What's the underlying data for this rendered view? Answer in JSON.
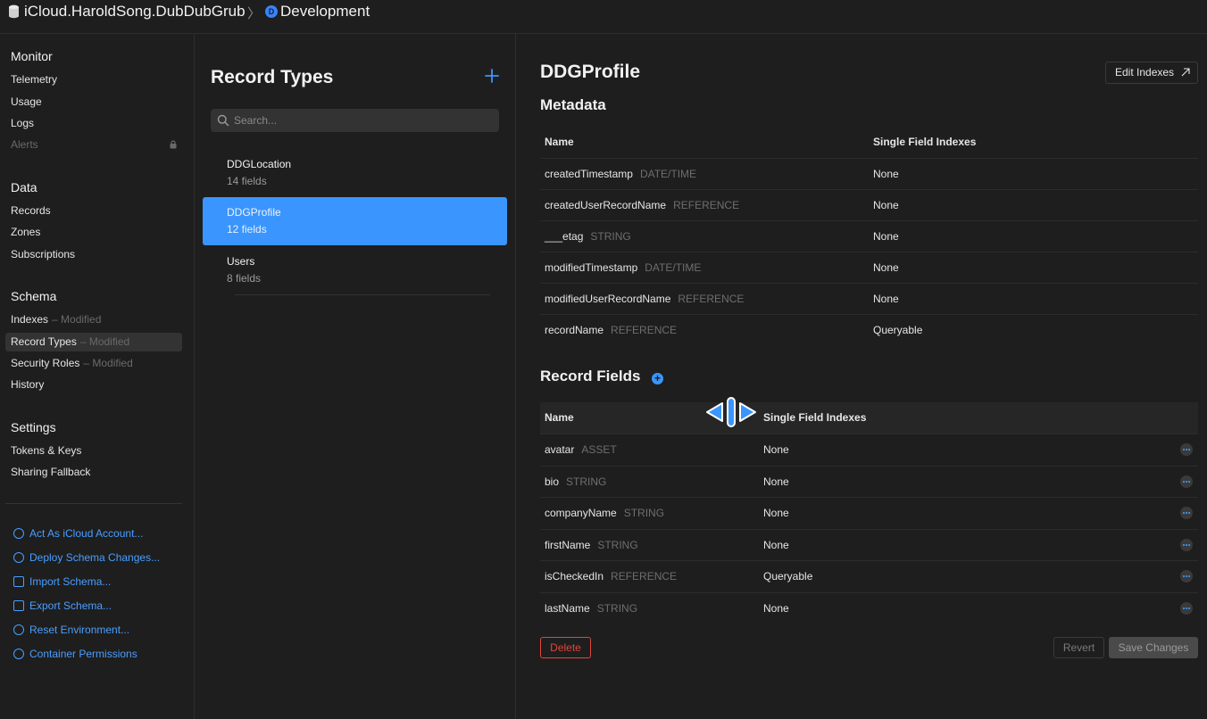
{
  "topbar": {
    "container": "iCloud.HaroldSong.DubDubGrub",
    "separator": "〉",
    "environment": "Development",
    "env_badge": "D"
  },
  "sidebar": {
    "monitor": {
      "heading": "Monitor",
      "items": [
        "Telemetry",
        "Usage",
        "Logs",
        "Alerts"
      ]
    },
    "data": {
      "heading": "Data",
      "items": [
        "Records",
        "Zones",
        "Subscriptions"
      ]
    },
    "schema": {
      "heading": "Schema",
      "items": [
        {
          "label": "Indexes",
          "status": "– Modified"
        },
        {
          "label": "Record Types",
          "status": "– Modified"
        },
        {
          "label": "Security Roles",
          "status": "– Modified"
        },
        {
          "label": "History",
          "status": ""
        }
      ]
    },
    "settings": {
      "heading": "Settings",
      "items": [
        "Tokens & Keys",
        "Sharing Fallback"
      ]
    },
    "actions": [
      "Act As iCloud Account...",
      "Deploy Schema Changes...",
      "Import Schema...",
      "Export Schema...",
      "Reset Environment...",
      "Container Permissions"
    ]
  },
  "record_types": {
    "title": "Record Types",
    "search_placeholder": "Search...",
    "items": [
      {
        "name": "DDGLocation",
        "fields": "14 fields"
      },
      {
        "name": "DDGProfile",
        "fields": "12 fields"
      },
      {
        "name": "Users",
        "fields": "8 fields"
      }
    ]
  },
  "detail": {
    "title": "DDGProfile",
    "edit_indexes": "Edit Indexes",
    "metadata": {
      "title": "Metadata",
      "col_name": "Name",
      "col_index": "Single Field Indexes",
      "rows": [
        {
          "name": "createdTimestamp",
          "type": "DATE/TIME",
          "index": "None"
        },
        {
          "name": "createdUserRecordName",
          "type": "REFERENCE",
          "index": "None"
        },
        {
          "name": "___etag",
          "type": "STRING",
          "index": "None"
        },
        {
          "name": "modifiedTimestamp",
          "type": "DATE/TIME",
          "index": "None"
        },
        {
          "name": "modifiedUserRecordName",
          "type": "REFERENCE",
          "index": "None"
        },
        {
          "name": "recordName",
          "type": "REFERENCE",
          "index": "Queryable"
        }
      ]
    },
    "record_fields": {
      "title": "Record Fields",
      "col_name": "Name",
      "col_index": "Single Field Indexes",
      "rows": [
        {
          "name": "avatar",
          "type": "ASSET",
          "index": "None"
        },
        {
          "name": "bio",
          "type": "STRING",
          "index": "None"
        },
        {
          "name": "companyName",
          "type": "STRING",
          "index": "None"
        },
        {
          "name": "firstName",
          "type": "STRING",
          "index": "None"
        },
        {
          "name": "isCheckedIn",
          "type": "REFERENCE",
          "index": "Queryable"
        },
        {
          "name": "lastName",
          "type": "STRING",
          "index": "None"
        }
      ]
    },
    "buttons": {
      "delete": "Delete",
      "revert": "Revert",
      "save": "Save Changes"
    }
  },
  "colors": {
    "accent": "#3a95ff",
    "link": "#4a9eff",
    "danger": "#e0463c",
    "background": "#1e1e1e"
  }
}
